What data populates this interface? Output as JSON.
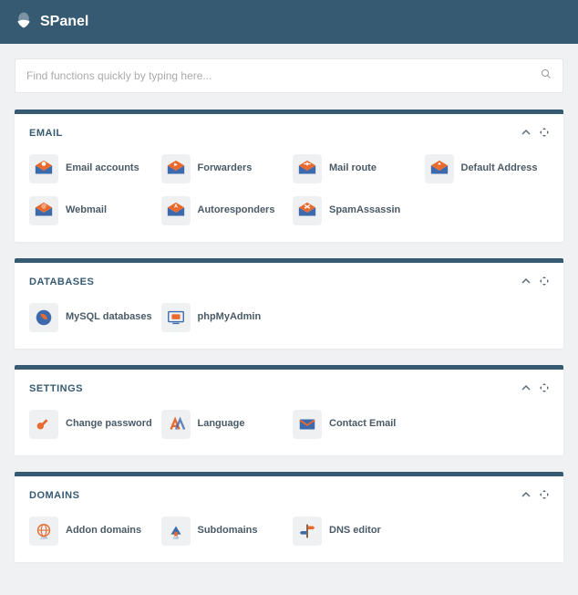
{
  "brand": {
    "name": "SPanel"
  },
  "search": {
    "placeholder": "Find functions quickly by typing here..."
  },
  "sections": {
    "email": {
      "title": "EMAIL",
      "items": [
        {
          "label": "Email accounts",
          "icon": "email-accounts-icon"
        },
        {
          "label": "Forwarders",
          "icon": "forwarders-icon"
        },
        {
          "label": "Mail route",
          "icon": "mail-route-icon"
        },
        {
          "label": "Default Address",
          "icon": "default-address-icon"
        },
        {
          "label": "Webmail",
          "icon": "webmail-icon"
        },
        {
          "label": "Autoresponders",
          "icon": "autoresponders-icon"
        },
        {
          "label": "SpamAssassin",
          "icon": "spamassassin-icon"
        }
      ]
    },
    "databases": {
      "title": "DATABASES",
      "items": [
        {
          "label": "MySQL databases",
          "icon": "mysql-icon"
        },
        {
          "label": "phpMyAdmin",
          "icon": "phpmyadmin-icon"
        }
      ]
    },
    "settings": {
      "title": "SETTINGS",
      "items": [
        {
          "label": "Change password",
          "icon": "key-icon"
        },
        {
          "label": "Language",
          "icon": "language-icon"
        },
        {
          "label": "Contact Email",
          "icon": "contact-email-icon"
        }
      ]
    },
    "domains": {
      "title": "DOMAINS",
      "items": [
        {
          "label": "Addon domains",
          "icon": "globe-icon"
        },
        {
          "label": "Subdomains",
          "icon": "subdomain-icon"
        },
        {
          "label": "DNS editor",
          "icon": "signpost-icon"
        }
      ]
    }
  },
  "colors": {
    "accent": "#365a72",
    "orange": "#e86a2e",
    "blue": "#3d6aad"
  }
}
